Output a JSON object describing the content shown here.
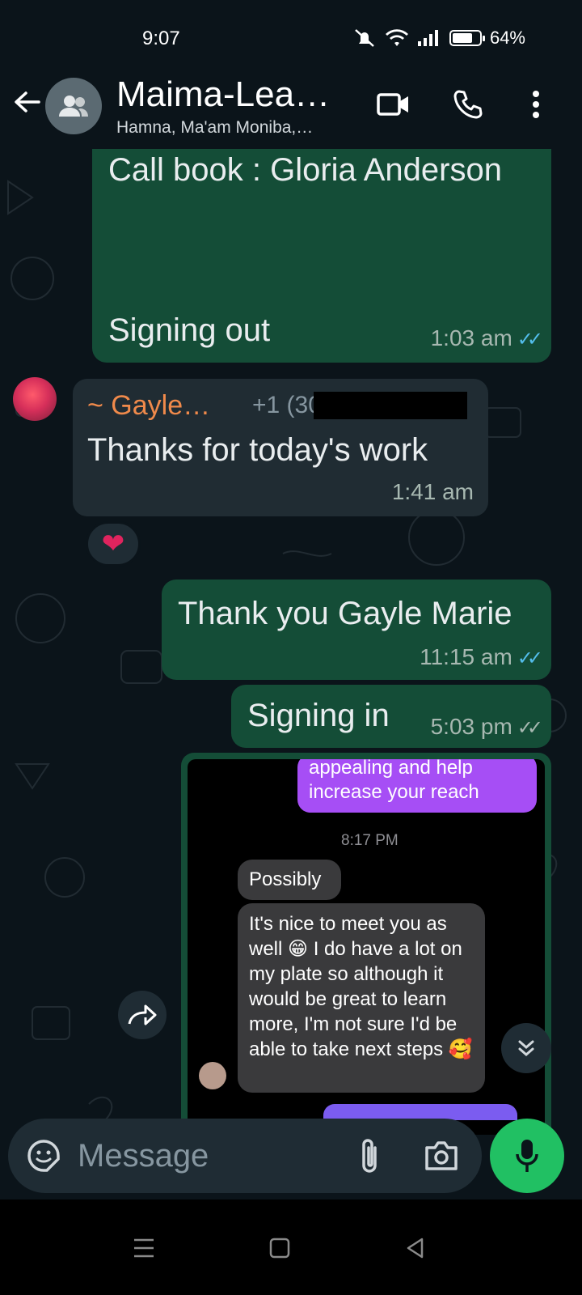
{
  "status_bar": {
    "time": "9:07",
    "battery": "64%"
  },
  "header": {
    "title": "Maima-Lea…",
    "subtitle": "Hamna, Ma'am Moniba,…"
  },
  "messages": [
    {
      "type": "outgoing",
      "line1": "Call book : Gloria Anderson",
      "line2": "Signing out",
      "time": "1:03 am",
      "read": true
    },
    {
      "type": "incoming",
      "sender": "~ Gayle…",
      "phone": "+1 (30",
      "text": "Thanks for today's work",
      "time": "1:41 am",
      "reaction": "❤"
    },
    {
      "type": "outgoing",
      "text": "Thank you Gayle Marie",
      "time": "11:15 am",
      "read": true
    },
    {
      "type": "outgoing",
      "text": "Signing in",
      "time": "5:03 pm",
      "read": false
    }
  ],
  "forwarded_image": {
    "purple_text": "appealing and help increase your reach",
    "timestamp": "8:17 PM",
    "bubble1": "Possibly",
    "bubble2": "It's nice to meet you as well 😁 I do have a lot on my plate so although it would be great to learn more, I'm not sure I'd be able to take next steps 🥰"
  },
  "input": {
    "placeholder": "Message"
  },
  "colors": {
    "outgoing_bubble": "#144d37",
    "incoming_bubble": "#202c33",
    "sender_name": "#f08a4b",
    "mic_button": "#21c063",
    "read_ticks": "#53bdeb"
  },
  "icons": [
    "back-arrow-icon",
    "group-icon",
    "video-call-icon",
    "phone-icon",
    "more-options-icon",
    "sticker-icon",
    "attach-icon",
    "camera-icon",
    "mic-icon",
    "forward-icon",
    "scroll-down-icon",
    "recents-icon",
    "home-icon",
    "back-nav-icon"
  ]
}
